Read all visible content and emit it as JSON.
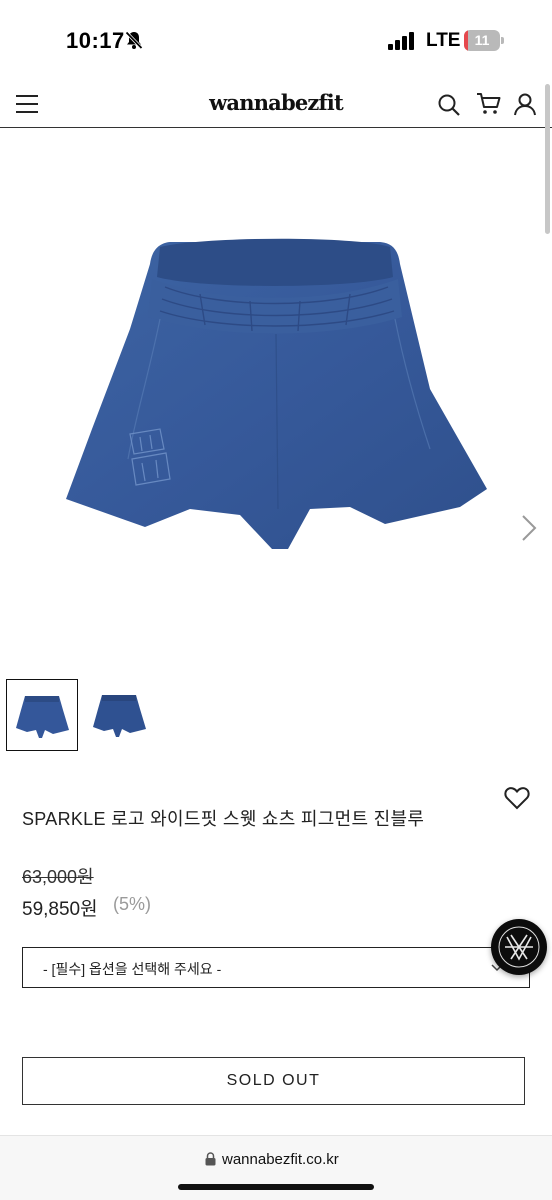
{
  "status_bar": {
    "time": "10:17",
    "network": "LTE",
    "battery_level": "11",
    "battery_fraction": 0.11,
    "icons": [
      "bell-slash-icon",
      "signal-icon"
    ]
  },
  "header": {
    "logo": "wannabezfit",
    "icons": [
      "menu-icon",
      "search-icon",
      "cart-icon",
      "user-icon"
    ]
  },
  "gallery": {
    "main_image": "navy-sweat-shorts",
    "thumbnails": [
      "thumbnail-front",
      "thumbnail-back"
    ],
    "next_icon": "chevron-right-icon"
  },
  "product": {
    "name": "SPARKLE 로고 와이드핏 스웻 쇼츠 피그먼트 진블루",
    "original_price": "63,000원",
    "sale_price": "59,850원",
    "discount": "(5%)",
    "wishlist_icon": "heart-icon"
  },
  "options": {
    "select_placeholder": "- [필수] 옵션을 선택해 주세요 -"
  },
  "actions": {
    "sold_out_label": "SOLD OUT"
  },
  "browser": {
    "url": "wannabezfit.co.kr"
  },
  "colors": {
    "product_blue": "#3a5d9a",
    "battery_low": "#e5484d",
    "discount_gray": "#9a9a9a"
  }
}
